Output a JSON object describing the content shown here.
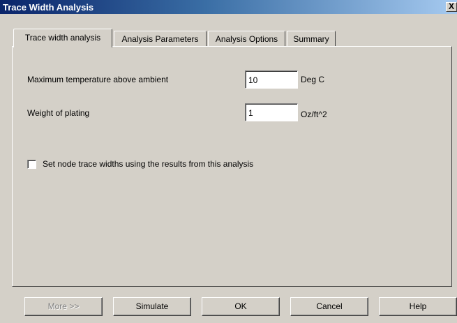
{
  "window": {
    "title": "Trace Width Analysis",
    "close_label": "X"
  },
  "tabs": [
    {
      "label": "Trace width analysis",
      "active": true
    },
    {
      "label": "Analysis Parameters",
      "active": false
    },
    {
      "label": "Analysis Options",
      "active": false
    },
    {
      "label": "Summary",
      "active": false
    }
  ],
  "form": {
    "max_temp": {
      "label": "Maximum temperature above ambient",
      "value": "10",
      "unit": "Deg C"
    },
    "plating": {
      "label": "Weight of plating",
      "value": "1",
      "unit": "Oz/ft^2"
    },
    "set_node_widths": {
      "label": "Set node trace widths using the results from this analysis",
      "checked": false
    }
  },
  "buttons": {
    "more": "More >>",
    "simulate": "Simulate",
    "ok": "OK",
    "cancel": "Cancel",
    "help": "Help"
  },
  "colors": {
    "face": "#d4d0c8",
    "title_start": "#0a246a",
    "title_end": "#a6caf0"
  }
}
